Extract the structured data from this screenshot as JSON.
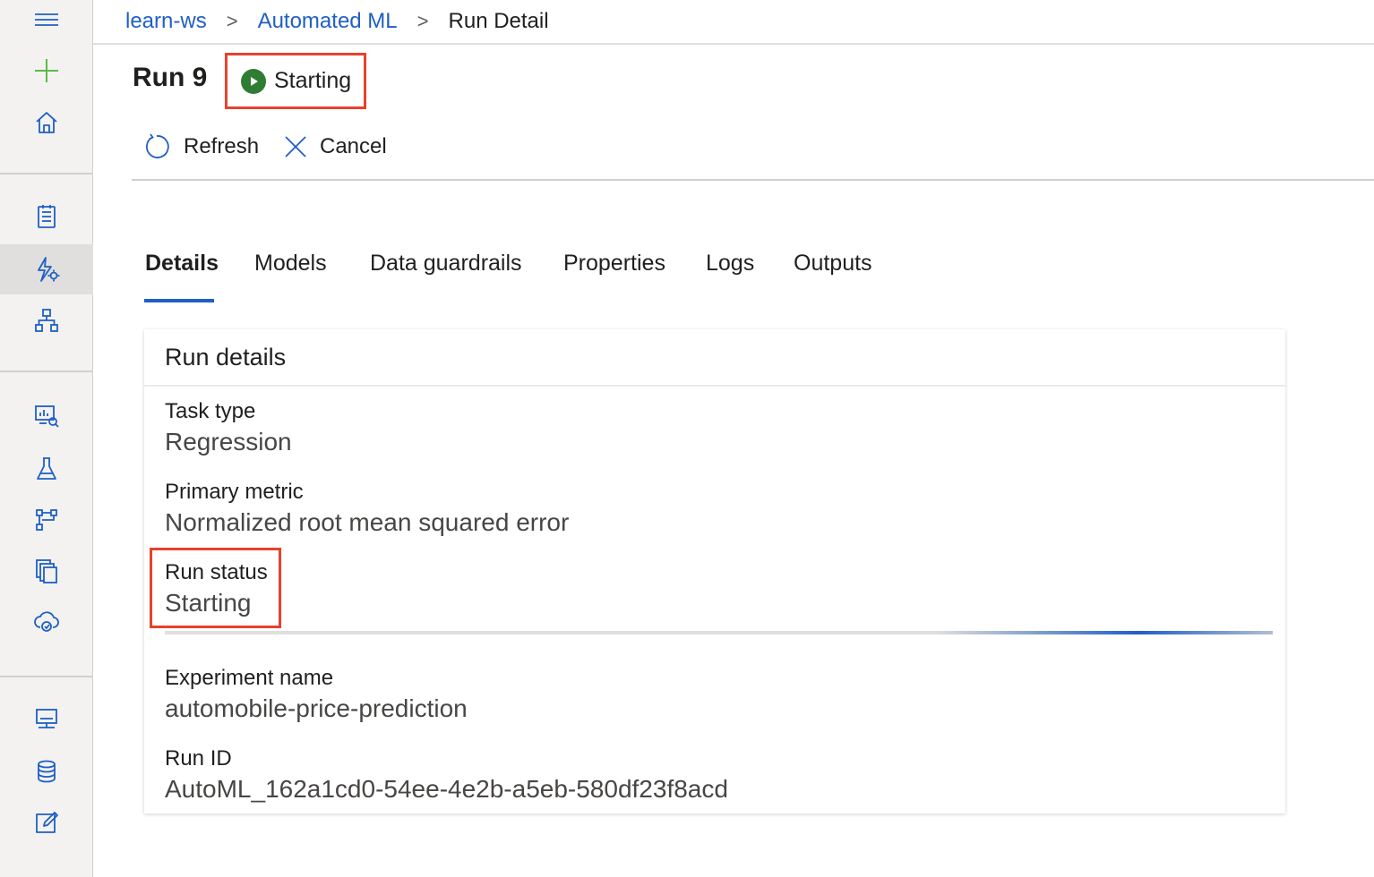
{
  "breadcrumb": {
    "workspace": "learn-ws",
    "section": "Automated ML",
    "current": "Run Detail",
    "separator": ">"
  },
  "run": {
    "title": "Run 9",
    "status": "Starting"
  },
  "toolbar": {
    "refresh_label": "Refresh",
    "cancel_label": "Cancel"
  },
  "tabs": [
    {
      "label": "Details",
      "active": true
    },
    {
      "label": "Models"
    },
    {
      "label": "Data guardrails"
    },
    {
      "label": "Properties"
    },
    {
      "label": "Logs"
    },
    {
      "label": "Outputs"
    }
  ],
  "details": {
    "header": "Run details",
    "task_type_label": "Task type",
    "task_type_value": "Regression",
    "primary_metric_label": "Primary metric",
    "primary_metric_value": "Normalized root mean squared error",
    "run_status_label": "Run status",
    "run_status_value": "Starting",
    "experiment_name_label": "Experiment name",
    "experiment_name_value": "automobile-price-prediction",
    "run_id_label": "Run ID",
    "run_id_value": "AutoML_162a1cd0-54ee-4e2b-a5eb-580df23f8acd"
  },
  "sidebar": {
    "icons": [
      "menu-icon",
      "plus-icon",
      "home-icon",
      "notebook-icon",
      "automl-icon",
      "designer-icon",
      "datasets-icon",
      "experiments-icon",
      "pipelines-icon",
      "models-icon",
      "endpoints-icon",
      "compute-icon",
      "datastores-icon",
      "labeling-icon"
    ]
  },
  "colors": {
    "accent": "#1f5fc4",
    "status_running": "#2e7d32",
    "highlight": "#e8412c",
    "plus": "#5db94a"
  }
}
